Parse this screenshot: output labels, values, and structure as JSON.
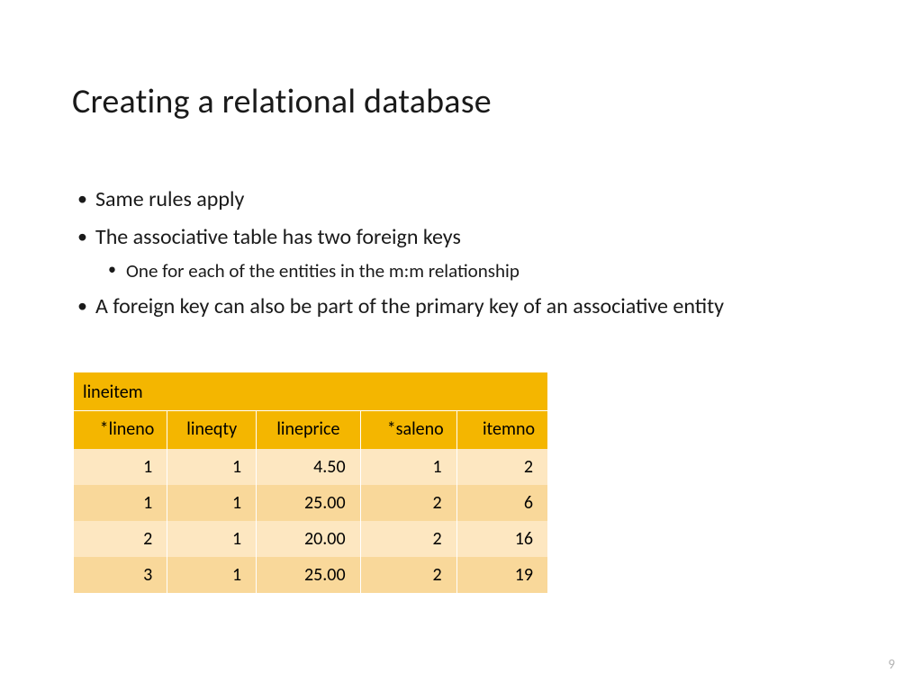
{
  "title": "Creating a relational database",
  "bullets": {
    "b1": "Same rules apply",
    "b2": "The associative table has two foreign keys",
    "b2_sub1": "One for each of the entities in the m:m relationship",
    "b3": "A foreign key can also be part of the primary key of an associative entity"
  },
  "table": {
    "name": "lineitem",
    "columns": [
      "*lineno",
      "lineqty",
      "lineprice",
      "*saleno",
      "itemno"
    ],
    "rows": [
      [
        "1",
        "1",
        "4.50",
        "1",
        "2"
      ],
      [
        "1",
        "1",
        "25.00",
        "2",
        "6"
      ],
      [
        "2",
        "1",
        "20.00",
        "2",
        "16"
      ],
      [
        "3",
        "1",
        "25.00",
        "2",
        "19"
      ]
    ]
  },
  "page_number": "9"
}
